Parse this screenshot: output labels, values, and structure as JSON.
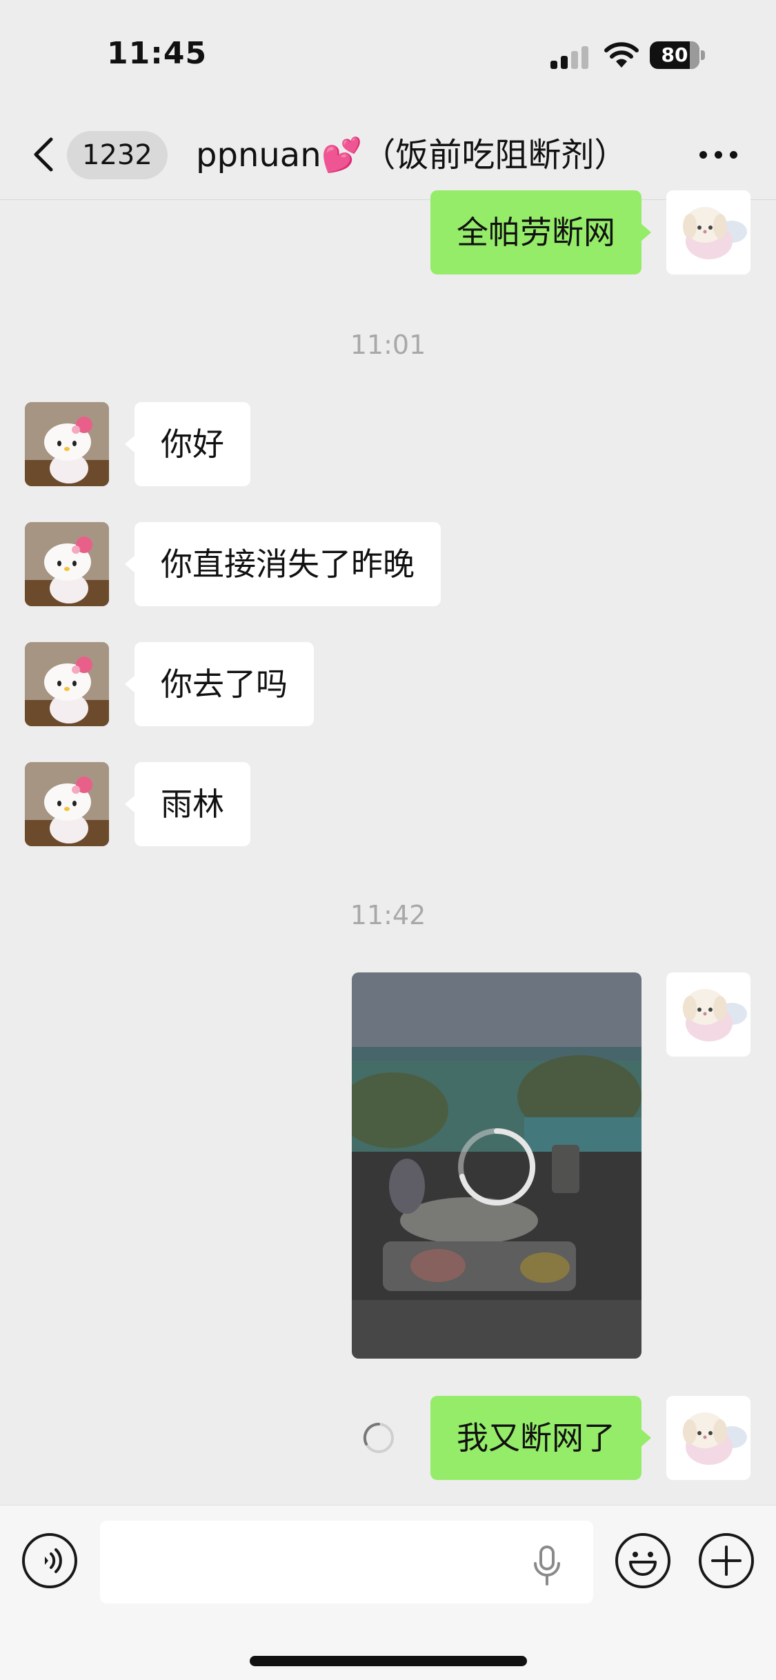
{
  "status_bar": {
    "time": "11:45",
    "battery": "80",
    "battery_level": 0.8
  },
  "nav": {
    "unread_count": "1232",
    "title": "ppnuan💕（饭前吃阻断剂）"
  },
  "messages": [
    {
      "type": "text",
      "from": "me",
      "text": "全帕劳断网"
    },
    {
      "type": "time",
      "text": "11:01"
    },
    {
      "type": "text",
      "from": "friend",
      "text": "你好"
    },
    {
      "type": "text",
      "from": "friend",
      "text": "你直接消失了昨晚"
    },
    {
      "type": "text",
      "from": "friend",
      "text": "你去了吗"
    },
    {
      "type": "text",
      "from": "friend",
      "text": "雨林"
    },
    {
      "type": "time",
      "text": "11:42"
    },
    {
      "type": "image",
      "from": "me",
      "status": "loading"
    },
    {
      "type": "text",
      "from": "me",
      "text": "我又断网了",
      "status": "sending"
    }
  ],
  "input": {
    "value": ""
  },
  "colors": {
    "outgoing_bubble": "#95ec69",
    "incoming_bubble": "#ffffff",
    "background": "#ededed"
  }
}
